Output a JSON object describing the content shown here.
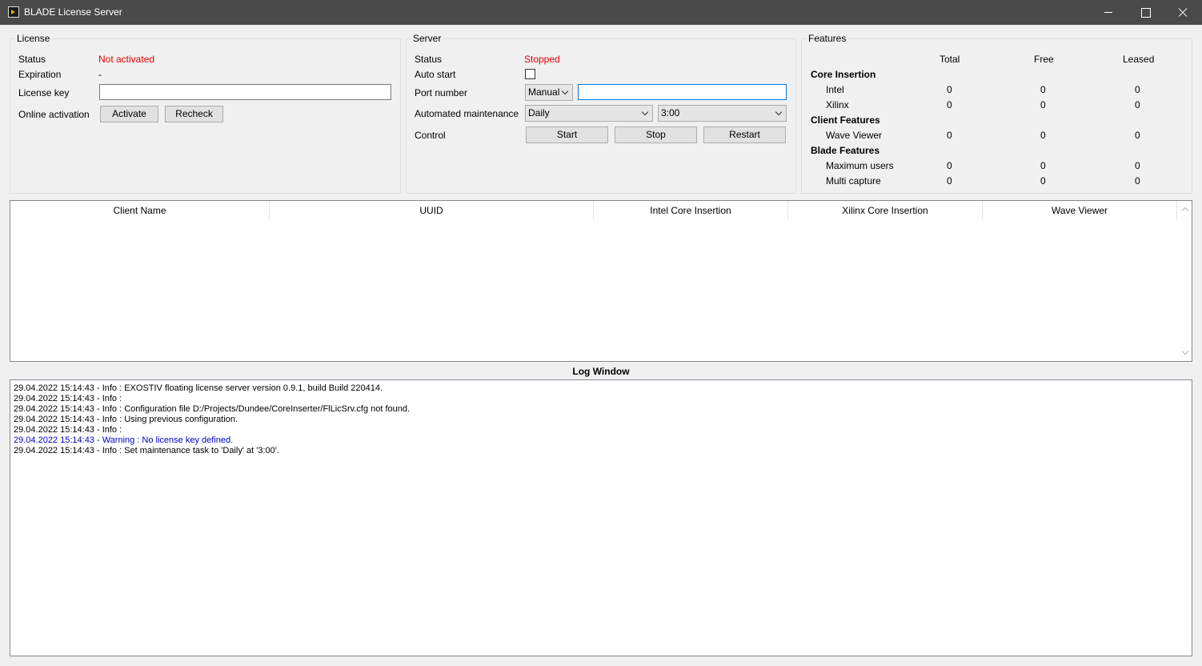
{
  "window": {
    "title": "BLADE License Server"
  },
  "license": {
    "group_title": "License",
    "status_label": "Status",
    "status_value": "Not activated",
    "expiration_label": "Expiration",
    "expiration_value": "-",
    "license_key_label": "License key",
    "license_key_value": "",
    "online_activation_label": "Online activation",
    "activate_button": "Activate",
    "recheck_button": "Recheck"
  },
  "server": {
    "group_title": "Server",
    "status_label": "Status",
    "status_value": "Stopped",
    "auto_start_label": "Auto start",
    "auto_start_checked": false,
    "port_number_label": "Port number",
    "port_mode_selected": "Manual",
    "port_value": "",
    "maintenance_label": "Automated maintenance",
    "maintenance_frequency": "Daily",
    "maintenance_time": "3:00",
    "control_label": "Control",
    "start_button": "Start",
    "stop_button": "Stop",
    "restart_button": "Restart"
  },
  "features": {
    "group_title": "Features",
    "col_total": "Total",
    "col_free": "Free",
    "col_leased": "Leased",
    "core_insertion_heading": "Core Insertion",
    "intel": {
      "name": "Intel",
      "total": "0",
      "free": "0",
      "leased": "0"
    },
    "xilinx": {
      "name": "Xilinx",
      "total": "0",
      "free": "0",
      "leased": "0"
    },
    "client_features_heading": "Client Features",
    "wave_viewer": {
      "name": "Wave Viewer",
      "total": "0",
      "free": "0",
      "leased": "0"
    },
    "blade_features_heading": "Blade Features",
    "maximum_users": {
      "name": "Maximum users",
      "total": "0",
      "free": "0",
      "leased": "0"
    },
    "multi_capture": {
      "name": "Multi capture",
      "total": "0",
      "free": "0",
      "leased": "0"
    }
  },
  "clients_table": {
    "columns": [
      "Client Name",
      "UUID",
      "Intel Core Insertion",
      "Xilinx Core Insertion",
      "Wave Viewer"
    ],
    "rows": []
  },
  "log": {
    "title": "Log Window",
    "lines": [
      "29.04.2022 15:14:43 - Info : EXOSTIV floating license server version 0.9.1, build Build 220414.",
      "29.04.2022 15:14:43 - Info :",
      "29.04.2022 15:14:43 - Info : Configuration file D:/Projects/Dundee/CoreInserter/FlLicSrv.cfg not found.",
      "29.04.2022 15:14:43 - Info : Using previous configuration.",
      "29.04.2022 15:14:43 - Info :",
      "29.04.2022 15:14:43 - Warning : No license key defined.",
      "29.04.2022 15:14:43 - Info : Set maintenance task to 'Daily' at '3:00'."
    ],
    "warning_color": "#0000c0"
  },
  "colors": {
    "titlebar": "#4a4a4a",
    "status_error": "#e00000",
    "focus_border": "#0078d7"
  }
}
